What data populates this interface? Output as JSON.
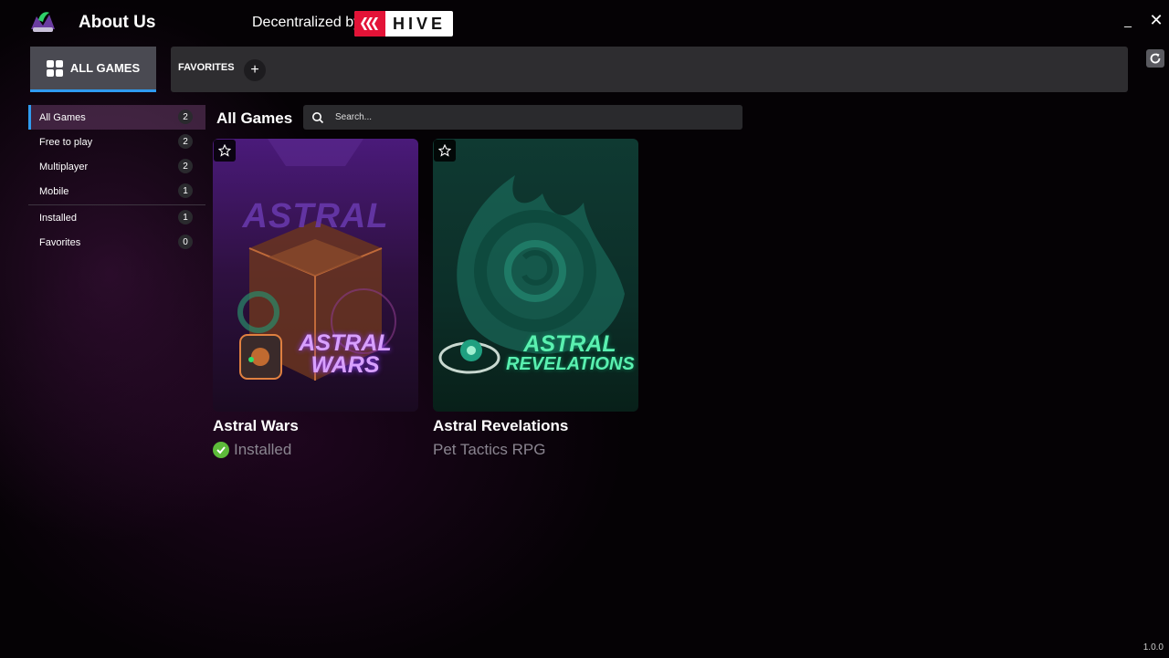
{
  "header": {
    "about_label": "About Us",
    "decentralized_label": "Decentralized by",
    "hive_label": "HIVE",
    "minimize_label": "_",
    "close_label": "✕"
  },
  "tabs": {
    "all_games_label": "ALL GAMES",
    "favorites_label": "FAVORITES",
    "add_label": "+"
  },
  "sidebar": {
    "items": [
      {
        "label": "All Games",
        "count": "2"
      },
      {
        "label": "Free to play",
        "count": "2"
      },
      {
        "label": "Multiplayer",
        "count": "2"
      },
      {
        "label": "Mobile",
        "count": "1"
      },
      {
        "label": "Installed",
        "count": "1"
      },
      {
        "label": "Favorites",
        "count": "0"
      }
    ]
  },
  "main": {
    "title": "All Games",
    "search_placeholder": "Search..."
  },
  "games": [
    {
      "title": "Astral Wars",
      "subtitle": "Installed",
      "art_top_text": "ASTRAL",
      "art_logo_line1": "ASTRAL",
      "art_logo_line2": "WARS"
    },
    {
      "title": "Astral Revelations",
      "subtitle": "Pet Tactics RPG",
      "art_logo_line1": "ASTRAL",
      "art_logo_line2": "REVELATIONS"
    }
  ],
  "version": "1.0.0",
  "colors": {
    "accent": "#2f9bf0",
    "hive_red": "#e31337",
    "installed_green": "#5dbb3a"
  }
}
